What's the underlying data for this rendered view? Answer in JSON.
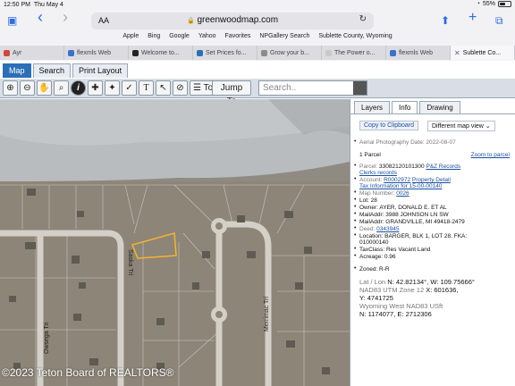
{
  "status": {
    "time": "12:50 PM",
    "day": "Thu May 4",
    "wifi": "◔",
    "battery": "55%",
    "battery_level": 0.55
  },
  "browser": {
    "aa": "AA",
    "lock": "🔒",
    "address": "greenwoodmap.com",
    "reload": "↻",
    "sidebar_icon": "▣",
    "back_icon": "‹",
    "forward_icon": "›",
    "share_icon": "⬆",
    "add_tab_icon": "+",
    "tabs_icon": "⧉",
    "favorites": [
      "Apple",
      "Bing",
      "Google",
      "Yahoo",
      "Favorites",
      "NPGallery Search",
      "Sublette County, Wyoming"
    ],
    "tabs": [
      {
        "title": "Ayr",
        "color": "#d0453b"
      },
      {
        "title": "flexmls Web",
        "color": "#3b6fd0"
      },
      {
        "title": "Welcome to...",
        "color": "#222222"
      },
      {
        "title": "Set Prices fo...",
        "color": "#2c6fb8"
      },
      {
        "title": "Grow your b...",
        "color": "#8b8b8b"
      },
      {
        "title": "The Power o...",
        "color": "#c9c9c9"
      },
      {
        "title": "flexmls Web",
        "color": "#3b6fd0"
      },
      {
        "title": "Sublette Co...",
        "color": "#555555",
        "active": true,
        "close": "✕"
      }
    ]
  },
  "app": {
    "tabs": [
      "Map",
      "Search",
      "Print Layout"
    ],
    "tools": {
      "zoom_in": "⊕",
      "zoom_out": "⊖",
      "pan": "✋",
      "zoom_box": "⌕",
      "identify": "i",
      "select": "✚",
      "measure": "✦",
      "line": "✓",
      "text": "T",
      "pointer": "↖",
      "clear": "⊘",
      "tools_label": "☰ Tools",
      "jump_label": "Jump To",
      "search_placeholder": "Search.."
    },
    "map": {
      "watermark": "©2023 Teton Board of REALTORS®",
      "streets": [
        "Saska Tri",
        "Owsega Tri",
        "Merrimac Trl"
      ]
    },
    "panel": {
      "tabs": [
        "Layers",
        "Info",
        "Drawing"
      ],
      "active_tab": "Info",
      "clipboard": "Copy to Clipboard",
      "map_view": "Different map view ⌄",
      "aerial": "Aerial Photography Date:  2022-08-07",
      "parcel_count": "1 Parcel",
      "zoom_to_parcel": "Zoom to parcel",
      "parcel_label": "Parcel: ",
      "parcel_id": "33082120101300",
      "pz_records": "P&Z Records",
      "clerks": "Clerks records",
      "account_label": "Account: ",
      "account": "R0002972",
      "property_detail": "Property Detail",
      "tax_info": "Tax Information for  15-00-00140",
      "map_number_label": "Map Number: ",
      "map_number": "0026",
      "lot": "Lot: 28",
      "owner": "Owner:  AYER, DONALD E. ET AL",
      "mail1": "MailAddr:  3988 JOHNSON LN SW",
      "mail2": "MailAddr:  GRANDVILLE, MI 49418-2479",
      "deed_label": "Deed: ",
      "deed": "0343945",
      "location1": "Location:  BARGER, BLK 1, LOT 28. FKA:",
      "location2": "010000140",
      "taxclass": "TaxClass:  Res Vacant Land",
      "acreage": "Acreage:  0.96",
      "zoned": "Zoned: R-R",
      "latlon_label": "Lat / Lon",
      "latlon": "N: 42.82134°, W: 109.75666°",
      "utm_label": "NAD83 UTM Zone 12",
      "utm_x": "X: 601636,",
      "utm_y": "Y: 4741725",
      "wy_label": "Wyoming West NAD83 USft",
      "wy": "N: 1174077, E: 2712306"
    }
  }
}
